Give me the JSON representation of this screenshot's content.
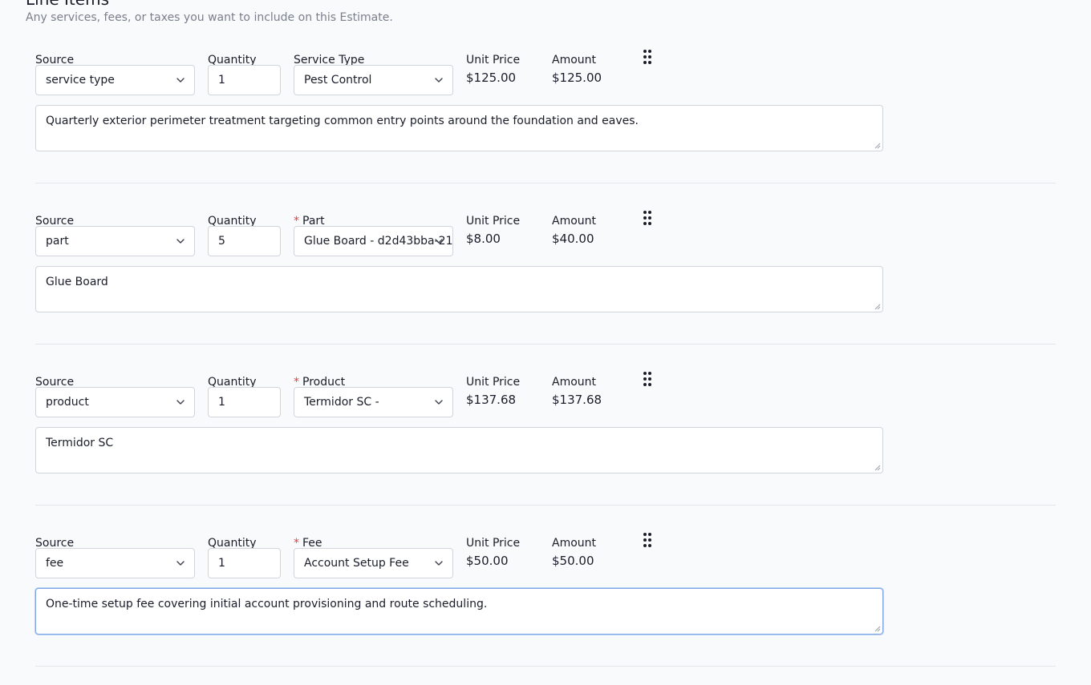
{
  "section": {
    "title": "Line Items",
    "subtitle": "Any services, fees, or taxes you want to include on this Estimate."
  },
  "labels": {
    "source": "Source",
    "quantity": "Quantity",
    "unit_price": "Unit Price",
    "amount": "Amount",
    "required_mark": "*"
  },
  "icons": {
    "drag": "drag-handle-icon",
    "chevron": "chevron-down-icon",
    "resize": "resize-grip-icon"
  },
  "items": [
    {
      "source": "service type",
      "quantity": "1",
      "type_label": "Service Type",
      "type_required": false,
      "type_value": "Pest Control",
      "unit_price": "$125.00",
      "amount": "$125.00",
      "description": "Quarterly exterior perimeter treatment targeting common entry points around the foundation and eaves."
    },
    {
      "source": "part",
      "quantity": "5",
      "type_label": "Part",
      "type_required": true,
      "type_value": "Glue Board - d2d43bba-21",
      "unit_price": "$8.00",
      "amount": "$40.00",
      "description": "Glue Board"
    },
    {
      "source": "product",
      "quantity": "1",
      "type_label": "Product",
      "type_required": true,
      "type_value": "Termidor SC -",
      "unit_price": "$137.68",
      "amount": "$137.68",
      "description": "Termidor SC"
    },
    {
      "source": "fee",
      "quantity": "1",
      "type_label": "Fee",
      "type_required": true,
      "type_value": "Account Setup Fee",
      "unit_price": "$50.00",
      "amount": "$50.00",
      "description": "One-time setup fee covering initial account provisioning and route scheduling."
    }
  ]
}
